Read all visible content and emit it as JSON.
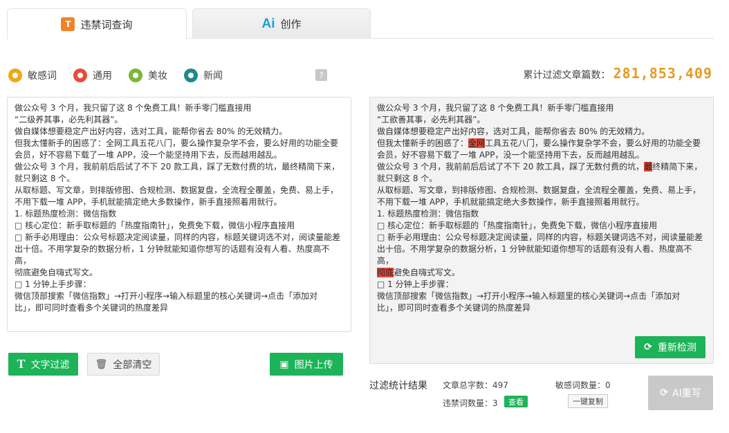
{
  "tabs": [
    {
      "label": "违禁词查询",
      "icon": "filter-doc-icon"
    },
    {
      "label": "创作",
      "icon": "ai-icon",
      "icon_text": "Ai"
    }
  ],
  "radios": [
    {
      "label": "敏感词",
      "color": "#f0a818",
      "selected": true
    },
    {
      "label": "通用",
      "color": "#e84a3c",
      "selected": false
    },
    {
      "label": "美妆",
      "color": "#7cb838",
      "selected": false
    },
    {
      "label": "新闻",
      "color": "#1e8a8c",
      "selected": false
    }
  ],
  "help": "?",
  "counter": {
    "label": "累计过滤文章篇数：",
    "value": "281,853,409"
  },
  "input_lines": [
    "做公众号 3 个月，我只留了这 8 个免费工具！新手零门槛直接用",
    "“二级养其事，必先利其器”。",
    "做自媒体想要稳定产出好内容，选对工具，能帮你省去 80% 的无效精力。",
    "但我太懂新手的困惑了：全网工具五花八门，要么操作复杂学不会，要么好用的功能全要",
    "会员，好不容易下载了一堆 APP，没一个能坚持用下去，反而越用越乱。",
    "做公众号 3 个月，我前前后后试了不下 20 款工具，踩了无数付费的坑，最终精简下来，",
    "就只剩这 8 个。",
    "从取标题、写文章，到排版修图、合规检测、数据复盘，全流程全覆盖，免费、易上手，",
    "不用下载一堆 APP，手机就能搞定绝大多数操作，新手直接照着用就行。",
    "1. 标题热度检测：微信指数",
    "□ 核心定位：新手取标题的「热度指南针」，免费免下载，微信小程序直接用",
    "□ 新手必用理由：公众号标题决定阅读量，同样的内容，标题关键词选不对，阅读量能差",
    "出十倍。不用学复杂的数据分析，1 分钟就能知道你想写的话题有没有人看、热度高不高，",
    "彻底避免自嗨式写文。",
    "□ 1 分钟上手步骤：",
    "微信顶部搜索「微信指数」→打开小程序→输入标题里的核心关键词→点击「添加对",
    "比」，即可同时查看多个关键词的热度差异"
  ],
  "output_lines": [
    {
      "parts": [
        "做公众号 3 个月，我只留了这 8 个免费工具！新手零门槛直接用"
      ]
    },
    {
      "parts": [
        "“工欲善其事，必先利其器”。"
      ]
    },
    {
      "parts": [
        "做自媒体想要稳定产出好内容，选对工具，能帮你省去 80% 的无效精力。"
      ]
    },
    {
      "parts": [
        "但我太懂新手的困惑了：",
        {
          "hl": "全网"
        },
        "工具五花八门，要么操作复杂学不会，要么好用的功能全要"
      ]
    },
    {
      "parts": [
        "会员，好不容易下载了一堆 APP，没一个能坚持用下去，反而越用越乱。"
      ]
    },
    {
      "parts": [
        "做公众号 3 个月，我前前后后试了不下 20 款工具，踩了无数付费的坑，",
        {
          "hl": "最"
        },
        "终精简下来，"
      ]
    },
    {
      "parts": [
        "就只剩这 8 个。"
      ]
    },
    {
      "parts": [
        "从取标题、写文章，到排版修图、合规检测、数据复盘，全流程全覆盖，免费、易上手，"
      ]
    },
    {
      "parts": [
        "不用下载一堆 APP，手机就能搞定绝大多数操作，新手直接照着用就行。"
      ]
    },
    {
      "parts": [
        "1. 标题热度检测：微信指数"
      ]
    },
    {
      "parts": [
        "□ 核心定位：新手取标题的「热度指南针」，免费免下载，微信小程序直接用"
      ]
    },
    {
      "parts": [
        "□ 新手必用理由：公众号标题决定阅读量，同样的内容，标题关键词选不对，阅读量能差"
      ]
    },
    {
      "parts": [
        "出十倍。不用学复杂的数据分析，1 分钟就能知道你想写的话题有没有人看、热度高不高，"
      ]
    },
    {
      "parts": [
        {
          "hl": "彻底"
        },
        "避免自嗨式写文。"
      ]
    },
    {
      "parts": [
        "□ 1 分钟上手步骤："
      ]
    },
    {
      "parts": [
        "微信顶部搜索「微信指数」→打开小程序→输入标题里的核心关键词→点击「添加对"
      ]
    },
    {
      "parts": [
        "比」，即可同时查看多个关键词的热度差异"
      ]
    }
  ],
  "buttons": {
    "text_filter": "文字过滤",
    "clear_all": "全部清空",
    "image_upload": "图片上传",
    "recheck": "重新检测",
    "ai_rewrite": "AI重写",
    "view": "查看",
    "copy": "一键复制"
  },
  "stats": {
    "title": "过滤统计结果",
    "total_words_label": "文章总字数：",
    "total_words": "497",
    "sensitive_label": "敏感词数量：",
    "sensitive": "0",
    "banned_label": "违禁词数量：",
    "banned": "3"
  },
  "colors": {
    "accent_green": "#1cb359",
    "counter_orange": "#e69a22",
    "highlight_red": "#e04a3b"
  }
}
